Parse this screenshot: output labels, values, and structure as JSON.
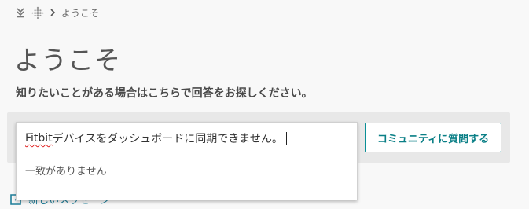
{
  "breadcrumb": {
    "items": [
      "ようこそ"
    ]
  },
  "page": {
    "title": "ようこそ",
    "subtitle": "知りたいことがある場合はこちらで回答をお探しください。"
  },
  "search": {
    "value_brand": "Fitbit",
    "value_rest": " デバイスをダッシュボードに同期できません。",
    "no_results": "一致がありません"
  },
  "ask_button": {
    "label": "コミュニティに質問する"
  },
  "new_message": {
    "label": "新しいメッセージ"
  },
  "colors": {
    "accent": "#0a8f96",
    "link": "#1f7f9a",
    "spell_underline": "#e02020"
  },
  "icons": [
    "collapse-icon",
    "fitbit-logo-icon",
    "chevron-right-icon",
    "new-message-icon"
  ]
}
